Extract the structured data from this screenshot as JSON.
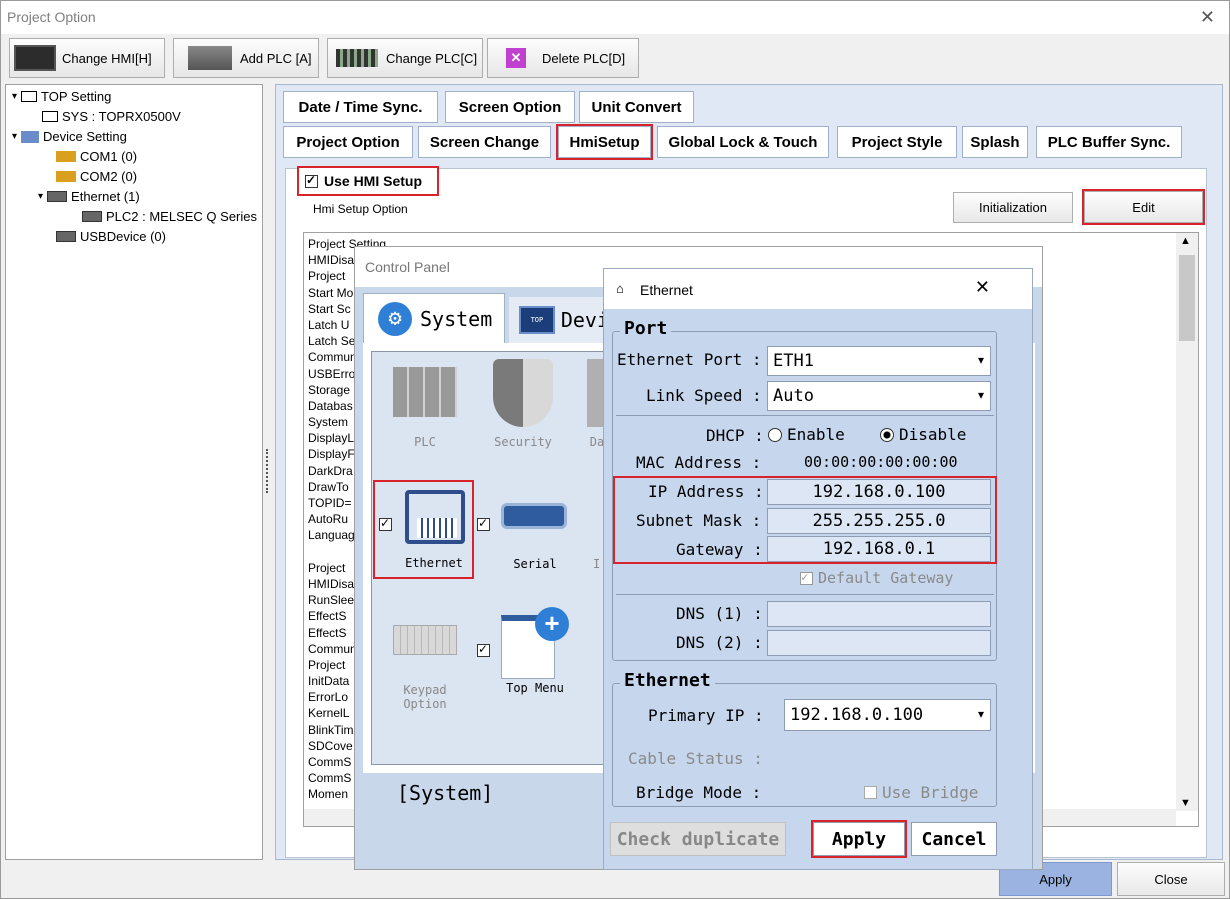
{
  "window": {
    "title": "Project Option"
  },
  "toolbar": [
    {
      "label": "Change HMI[H]",
      "icon": "hmi-icon"
    },
    {
      "label": "Add PLC [A]",
      "icon": "plc-icon"
    },
    {
      "label": "Change PLC[C]",
      "icon": "plc-change-icon"
    },
    {
      "label": "Delete PLC[D]",
      "icon": "delete-icon"
    }
  ],
  "tree": {
    "items": [
      "TOP Setting",
      "SYS : TOPRX0500V",
      "Device Setting",
      "COM1 (0)",
      "COM2 (0)",
      "Ethernet (1)",
      "PLC2 : MELSEC Q Series",
      "USBDevice (0)"
    ]
  },
  "tabs": {
    "row1": [
      "Date / Time Sync.",
      "Screen Option",
      "Unit Convert"
    ],
    "row2": [
      "Project Option",
      "Screen Change",
      "HmiSetup",
      "Global Lock & Touch",
      "Project Style",
      "Splash",
      "PLC Buffer Sync."
    ]
  },
  "hmisetup": {
    "use_label": "Use HMI Setup",
    "option_label": "Hmi Setup Option",
    "init_button": "Initialization",
    "edit_button": "Edit",
    "list": [
      "Project Setting",
      "HMIDisa",
      "Project",
      "Start Mo",
      "Start Sc",
      "Latch U",
      "Latch Se",
      "Commun",
      "USBErro",
      "Storage",
      "Databas",
      "System",
      "DisplayL",
      "DisplayF",
      "DarkDra",
      "DrawTo",
      "TOPID=",
      "AutoRu",
      "Languag",
      "",
      "Project",
      "HMIDisa",
      "RunSlee",
      "EffectS",
      "EffectS",
      "Commun",
      "Project",
      "InitData",
      "ErrorLo",
      "KernelL",
      "BlinkTim",
      "SDCove",
      "CommS",
      "CommS",
      "Momen"
    ]
  },
  "bottom": {
    "apply": "Apply",
    "close": "Close"
  },
  "control_panel": {
    "title": "Control Panel",
    "tab_system": "System",
    "tab_device": "Devi",
    "items": [
      "PLC",
      "Security",
      "Da",
      "Ethernet",
      "Serial",
      "I",
      "Keypad Option",
      "Top Menu"
    ],
    "footer": "[System]"
  },
  "ethernet": {
    "title": "Ethernet",
    "port_group": "Port",
    "ethernet_port_label": "Ethernet Port :",
    "ethernet_port_value": "ETH1",
    "link_speed_label": "Link Speed :",
    "link_speed_value": "Auto",
    "dhcp_label": "DHCP :",
    "dhcp_enable": "Enable",
    "dhcp_disable": "Disable",
    "mac_label": "MAC Address :",
    "mac_value": "00:00:00:00:00:00",
    "ip_label": "IP Address :",
    "ip_value": "192.168.0.100",
    "subnet_label": "Subnet Mask :",
    "subnet_value": "255.255.255.0",
    "gateway_label": "Gateway :",
    "gateway_value": "192.168.0.1",
    "default_gateway": "Default Gateway",
    "dns1_label": "DNS (1) :",
    "dns2_label": "DNS (2) :",
    "eth_group": "Ethernet",
    "primary_ip_label": "Primary IP :",
    "primary_ip_value": "192.168.0.100",
    "cable_status_label": "Cable Status :",
    "bridge_mode_label": "Bridge Mode :",
    "use_bridge": "Use Bridge",
    "check_duplicate": "Check duplicate",
    "apply": "Apply",
    "cancel": "Cancel"
  },
  "colors": {
    "highlight": "#d8232a",
    "panel": "#c6d6ec"
  }
}
